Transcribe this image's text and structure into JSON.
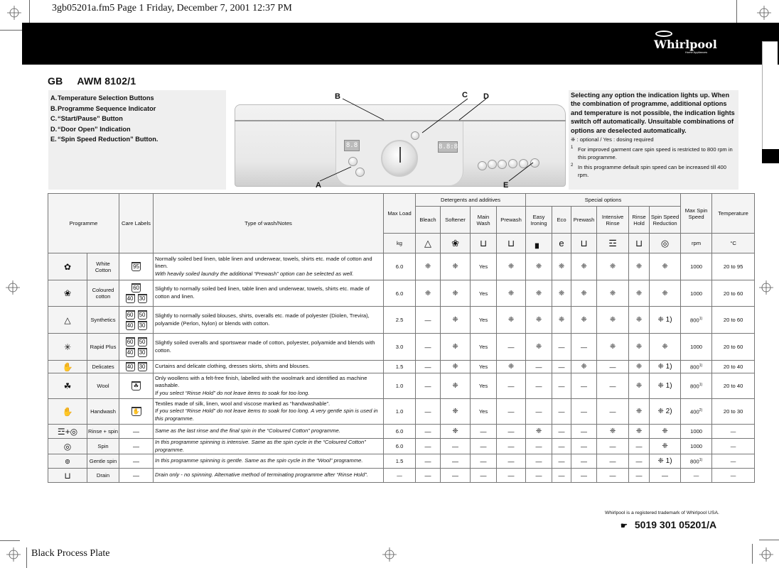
{
  "slug": "3gb05201a.fm5  Page 1  Friday, December 7, 2001  12:37 PM",
  "brand": {
    "name": "Whirlpool",
    "tagline": "Home Appliances"
  },
  "model": {
    "country": "GB",
    "code": "AWM 8102/1"
  },
  "legend": [
    {
      "letter": "A.",
      "text": "Temperature Selection Buttons"
    },
    {
      "letter": "B.",
      "text": "Programme Sequence Indicator"
    },
    {
      "letter": "C.",
      "text": "“Start/Pause” Button"
    },
    {
      "letter": "D.",
      "text": "“Door Open” Indication"
    },
    {
      "letter": "E.",
      "text": "“Spin Speed Reduction” Button."
    }
  ],
  "panel": {
    "callouts": [
      "A",
      "B",
      "C",
      "D",
      "E"
    ],
    "temp_display": "8.8",
    "time_display": "8.8:8",
    "brand_script": "Whirlpool"
  },
  "notes": {
    "main": "Selecting any option the indication lights up. When the combination of programme, additional options and temperature is not possible, the indication lights switch off automatically. Unsuitable combinations of options are deselected automatically.",
    "key": "❈ : optional  /  Yes : dosing required",
    "footnotes": [
      {
        "mark": "1",
        "text": "For improved garment care spin speed is restricted to 800 rpm in this programme."
      },
      {
        "mark": "2",
        "text": "In this programme default spin speed can be increased till 400 rpm."
      }
    ]
  },
  "table": {
    "headers": {
      "programme": "Programme",
      "care_labels": "Care Labels",
      "type": "Type of wash/Notes",
      "max_load": "Max Load",
      "max_load_unit": "kg",
      "detergents_group": "Detergents and additives",
      "special_group": "Special options",
      "max_spin": "Max Spin Speed",
      "max_spin_unit": "rpm",
      "temperature": "Temperature",
      "temperature_unit": "°C",
      "columns": [
        {
          "label": "Bleach",
          "icon": "△"
        },
        {
          "label": "Softener",
          "icon": "❀"
        },
        {
          "label": "Main Wash",
          "icon": "⊔"
        },
        {
          "label": "Prewash",
          "icon": "⊔"
        },
        {
          "label": "Easy Ironing",
          "icon": "▖"
        },
        {
          "label": "Eco",
          "icon": "e"
        },
        {
          "label": "Prewash",
          "icon": "⊔"
        },
        {
          "label": "Intensive Rinse",
          "icon": "☲"
        },
        {
          "label": "Rinse Hold",
          "icon": "⊔"
        },
        {
          "label": "Spin Speed Reduction",
          "icon": "◎"
        }
      ]
    },
    "rows": [
      {
        "icon": "✿",
        "name": "White Cotton",
        "care": [
          "95"
        ],
        "desc": "Normally soiled bed linen, table linen and underwear, towels, shirts etc. made of cotton and linen.",
        "desc_it": "With heavily soiled laundry the additional “Prewash” option can be selected as well.",
        "load": "6.0",
        "opts": [
          "❈",
          "❈",
          "Yes",
          "❈",
          "❈",
          "❈",
          "❈",
          "❈",
          "❈",
          "❈"
        ],
        "spin": "1000",
        "spin_fn": "",
        "temp": "20 to 95"
      },
      {
        "icon": "❀",
        "name": "Coloured cotton",
        "care": [
          "60",
          "40",
          "30"
        ],
        "desc": "Slightly to normally soiled bed linen, table linen and underwear, towels, shirts etc. made of cotton and linen.",
        "desc_it": "",
        "load": "6.0",
        "opts": [
          "❈",
          "❈",
          "Yes",
          "❈",
          "❈",
          "❈",
          "❈",
          "❈",
          "❈",
          "❈"
        ],
        "spin": "1000",
        "spin_fn": "",
        "temp": "20 to 60"
      },
      {
        "icon": "△",
        "name": "Synthetics",
        "care": [
          "60",
          "50",
          "40",
          "30"
        ],
        "desc": "Slightly to normally soiled blouses, shirts, overalls etc. made of polyester (Diolen, Trevira), polyamide (Perlon, Nylon) or blends with cotton.",
        "desc_it": "",
        "load": "2.5",
        "opts": [
          "—",
          "❈",
          "Yes",
          "❈",
          "❈",
          "❈",
          "❈",
          "❈",
          "❈",
          "❈ 1)"
        ],
        "spin": "800",
        "spin_fn": "1)",
        "temp": "20 to 60"
      },
      {
        "icon": "✳",
        "name": "Rapid Plus",
        "care": [
          "60",
          "50",
          "40",
          "30"
        ],
        "desc": "Slightly soiled overalls and sportswear made of cotton, polyester, polyamide and blends with cotton.",
        "desc_it": "",
        "load": "3.0",
        "opts": [
          "—",
          "❈",
          "Yes",
          "—",
          "❈",
          "—",
          "—",
          "❈",
          "❈",
          "❈"
        ],
        "spin": "1000",
        "spin_fn": "",
        "temp": "20 to 60"
      },
      {
        "icon": "✋",
        "name": "Delicates",
        "care": [
          "40",
          "30"
        ],
        "desc": "Curtains and delicate clothing, dresses skirts, shirts and blouses.",
        "desc_it": "",
        "load": "1.5",
        "opts": [
          "—",
          "❈",
          "Yes",
          "❈",
          "—",
          "—",
          "❈",
          "—",
          "❈",
          "❈ 1)"
        ],
        "spin": "800",
        "spin_fn": "1)",
        "temp": "20 to 40"
      },
      {
        "icon": "☘",
        "name": "Wool",
        "care": [
          "☘"
        ],
        "desc": "Only woollens with a felt-free finish, labelled with the woolmark and identified as machine washable.",
        "desc_it": "If you select “Rinse Hold” do not leave items to soak for too long.",
        "load": "1.0",
        "opts": [
          "—",
          "❈",
          "Yes",
          "—",
          "—",
          "—",
          "—",
          "—",
          "❈",
          "❈ 1)"
        ],
        "spin": "800",
        "spin_fn": "1)",
        "temp": "20 to 40"
      },
      {
        "icon": "✋",
        "name": "Handwash",
        "care": [
          "✋"
        ],
        "desc": "Textiles made of silk, linen, wool and viscose marked as “handwashable”.",
        "desc_it": "If you select “Rinse Hold” do not leave items to soak for too long. A very gentle spin is used in this programme.",
        "load": "1.0",
        "opts": [
          "—",
          "❈",
          "Yes",
          "—",
          "—",
          "—",
          "—",
          "—",
          "❈",
          "❈ 2)"
        ],
        "spin": "400",
        "spin_fn": "2)",
        "temp": "20 to 30"
      },
      {
        "icon": "☲+◎",
        "name": "Rinse + spin",
        "care": [
          "—"
        ],
        "desc": "",
        "desc_it": "Same as the last rinse and the final spin in the “Coloured Cotton” programme.",
        "load": "6.0",
        "opts": [
          "—",
          "❈",
          "—",
          "—",
          "❈",
          "—",
          "—",
          "❈",
          "❈",
          "❈"
        ],
        "spin": "1000",
        "spin_fn": "",
        "temp": "—"
      },
      {
        "icon": "◎",
        "name": "Spin",
        "care": [
          "—"
        ],
        "desc": "",
        "desc_it": "In this programme spinning is intensive. Same as the spin cycle in the “Coloured Cotton” programme.",
        "load": "6.0",
        "opts": [
          "—",
          "—",
          "—",
          "—",
          "—",
          "—",
          "—",
          "—",
          "—",
          "❈"
        ],
        "spin": "1000",
        "spin_fn": "",
        "temp": "—"
      },
      {
        "icon": "๏",
        "name": "Gentle spin",
        "care": [
          "—"
        ],
        "desc": "",
        "desc_it": "In this programme spinning is gentle. Same as the spin cycle in the “Wool” programme.",
        "load": "1.5",
        "opts": [
          "—",
          "—",
          "—",
          "—",
          "—",
          "—",
          "—",
          "—",
          "—",
          "❈ 1)"
        ],
        "spin": "800",
        "spin_fn": "1)",
        "temp": "—"
      },
      {
        "icon": "⊔",
        "name": "Drain",
        "care": [
          "—"
        ],
        "desc": "",
        "desc_it": "Drain only - no spinning. Alternative method of terminating programme after “Rinse Hold”.",
        "load": "—",
        "opts": [
          "—",
          "—",
          "—",
          "—",
          "—",
          "—",
          "—",
          "—",
          "—",
          "—"
        ],
        "spin": "—",
        "spin_fn": "",
        "temp": "—"
      }
    ]
  },
  "footer": {
    "trademark": "Whirlpool is a registered trademark of Whirlpool USA.",
    "part_number": "5019 301 05201/A",
    "plate": "Black Process Plate"
  }
}
